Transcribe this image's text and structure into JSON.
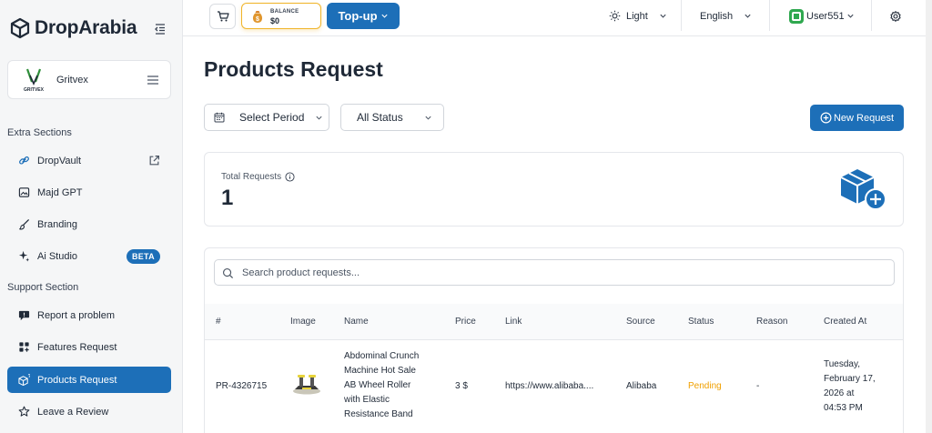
{
  "brand": {
    "name": "DropArabia"
  },
  "store": {
    "name": "Gritvex",
    "logo_text": "GRITVEX"
  },
  "sidebar": {
    "extra_title": "Extra Sections",
    "extra_items": [
      {
        "label": "DropVault"
      },
      {
        "label": "Majd GPT"
      },
      {
        "label": "Branding"
      },
      {
        "label": "Ai Studio",
        "badge": "BETA"
      }
    ],
    "support_title": "Support Section",
    "support_items": [
      {
        "label": "Report a problem"
      },
      {
        "label": "Features Request"
      },
      {
        "label": "Products Request"
      },
      {
        "label": "Leave a Review"
      }
    ]
  },
  "topbar": {
    "balance_label": "BALANCE",
    "balance_value": "$0",
    "topup_label": "Top-up",
    "theme_label": "Light",
    "language_label": "English",
    "user_label": "User551"
  },
  "page": {
    "title": "Products Request",
    "period_filter": "Select Period",
    "status_filter": "All Status",
    "new_request_label": "New Request",
    "total_label": "Total Requests",
    "total_value": "1",
    "search_placeholder": "Search product requests..."
  },
  "table": {
    "headers": [
      "#",
      "Image",
      "Name",
      "Price",
      "Link",
      "Source",
      "Status",
      "Reason",
      "Created At"
    ],
    "rows": [
      {
        "id": "PR-4326715",
        "name_lines": [
          "Abdominal Crunch",
          "Machine Hot Sale",
          "AB Wheel Roller",
          "with Elastic",
          "Resistance Band"
        ],
        "price": "3 $",
        "link": "https://www.alibaba....",
        "source": "Alibaba",
        "status": "Pending",
        "reason": "-",
        "created_lines": [
          "Tuesday,",
          "February 17,",
          "2026 at",
          "04:53 PM"
        ]
      }
    ]
  },
  "colors": {
    "accent": "#1d6fb8",
    "pending": "#f0a000",
    "balance_border": "#f0b429"
  }
}
